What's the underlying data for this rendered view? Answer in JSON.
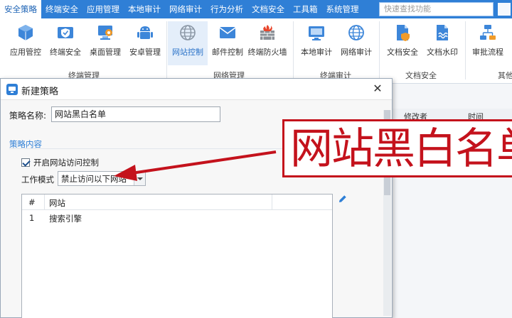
{
  "menubar": {
    "items": [
      {
        "label": "安全策略",
        "active": true
      },
      {
        "label": "终端安全",
        "active": false
      },
      {
        "label": "应用管理",
        "active": false
      },
      {
        "label": "本地审计",
        "active": false
      },
      {
        "label": "网络审计",
        "active": false
      },
      {
        "label": "行为分析",
        "active": false
      },
      {
        "label": "文档安全",
        "active": false
      },
      {
        "label": "工具箱",
        "active": false
      },
      {
        "label": "系统管理",
        "active": false
      }
    ],
    "search_placeholder": "快速查找功能"
  },
  "ribbon": {
    "buttons": [
      {
        "label": "应用管控",
        "icon": "cube-shield-icon"
      },
      {
        "label": "终端安全",
        "icon": "shield-check-icon"
      },
      {
        "label": "桌面管理",
        "icon": "desktop-gear-icon"
      },
      {
        "label": "安卓管理",
        "icon": "android-icon"
      },
      {
        "label": "网站控制",
        "icon": "globe-icon",
        "active": true
      },
      {
        "label": "邮件控制",
        "icon": "mail-icon"
      },
      {
        "label": "终端防火墙",
        "icon": "firewall-icon"
      },
      {
        "label": "本地审计",
        "icon": "monitor-audit-icon"
      },
      {
        "label": "网络审计",
        "icon": "globe-audit-icon"
      },
      {
        "label": "文档安全",
        "icon": "document-shield-icon"
      },
      {
        "label": "文档水印",
        "icon": "document-watermark-icon"
      },
      {
        "label": "审批流程",
        "icon": "workflow-icon"
      }
    ],
    "groups": [
      "终端管理",
      "网络管理",
      "终端审计",
      "文档安全",
      "其他"
    ]
  },
  "background_table": {
    "columns": [
      "修改者",
      "时间"
    ]
  },
  "dialog": {
    "title": "新建策略",
    "close_glyph": "✕",
    "name_label": "策略名称:",
    "name_value": "网站黑白名单",
    "section_title": "策略内容",
    "checkbox_label": "开启网站访问控制",
    "checkbox_checked": true,
    "mode_label": "工作模式",
    "mode_value": "禁止访问以下网站",
    "grid": {
      "columns": [
        "#",
        "网站"
      ],
      "rows": [
        {
          "index": "1",
          "site": "搜索引擎"
        }
      ]
    }
  },
  "annotation": {
    "text": "网站黑白名单",
    "color": "#c4121c"
  },
  "colors": {
    "accent": "#2f7fd6"
  }
}
